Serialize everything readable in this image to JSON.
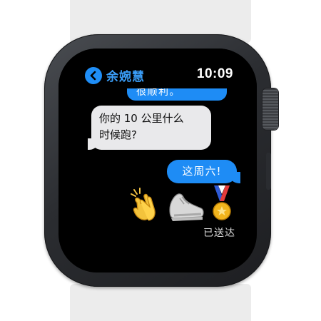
{
  "header": {
    "contact_name": "余婉慧",
    "time": "10:09",
    "back_icon": "chevron-left-icon"
  },
  "messages": [
    {
      "direction": "outgoing",
      "text": "很顺利。",
      "partially_visible": true
    },
    {
      "direction": "incoming",
      "lines": [
        "你的 10 公里什么",
        "时候跑?"
      ]
    },
    {
      "direction": "outgoing",
      "text": "这周六!"
    }
  ],
  "reactions": [
    "clapping-hands-icon",
    "running-shoe-icon",
    "medal-icon"
  ],
  "status": "已送达",
  "colors": {
    "accent": "#1e8cf5",
    "incoming_bubble": "#e9e9eb",
    "screen": "#000000",
    "case": "#2b2d31"
  }
}
